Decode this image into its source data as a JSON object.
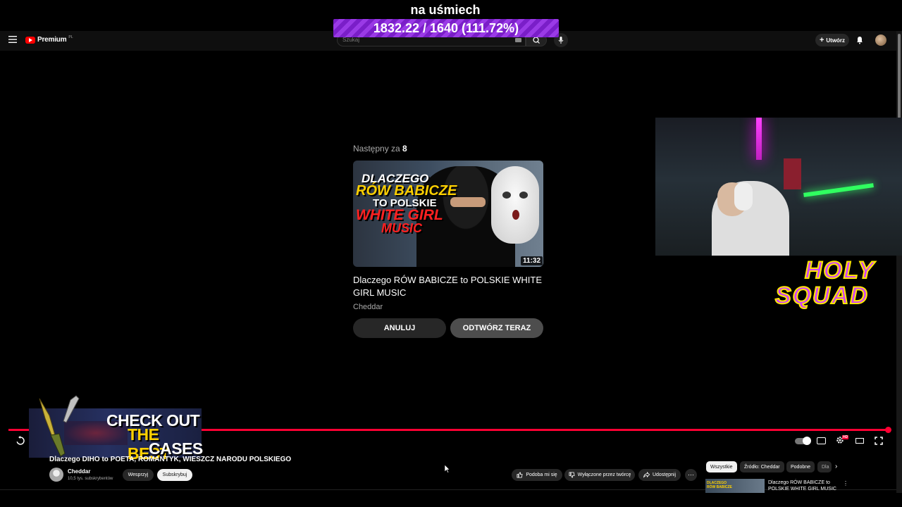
{
  "overlay": {
    "title": "na uśmiech",
    "progress_text": "1832.22 / 1640 (111.72%)",
    "progress_fraction": 1.0
  },
  "header": {
    "logo_text": "Premium",
    "logo_country": "PL",
    "search_placeholder": "Szukaj",
    "create_label": "Utwórz"
  },
  "up_next": {
    "label": "Następny za",
    "countdown": "8",
    "thumbnail": {
      "line1": "DLACZEGO",
      "line2": "RÓW BABICZE",
      "line3": "TO POLSKIE",
      "line4": "WHITE GIRL",
      "line5": "MUSIC",
      "duration": "11:32"
    },
    "title": "Dlaczego RÓW BABICZE to POLSKIE WHITE GIRL MUSIC",
    "channel": "Cheddar",
    "cancel_label": "ANULUJ",
    "play_now_label": "ODTWÓRZ TERAZ"
  },
  "stream_branding": {
    "holy_line1": "HOLY",
    "holy_line2": "SQUAD"
  },
  "promo": {
    "line1": "CHECK OUT",
    "line2": "THE BEST",
    "line3": "CASES"
  },
  "player": {
    "progress_fraction": 1.0,
    "hd_badge": "HD"
  },
  "video": {
    "title": "Dlaczego DIHO to POETA, ROMANTYK, WIESZCZ NARODU POLSKIEGO",
    "channel_name": "Cheddar",
    "subscribers": "10,5 tys. subskrybentów",
    "support_label": "Wesprzyj",
    "subscribe_label": "Subskrybuj",
    "like_label": "Podoba mi się",
    "dislike_label": "Wyłączone przez twórcę",
    "share_label": "Udostępnij"
  },
  "related": {
    "chips": [
      "Wszystkie",
      "Źródło: Cheddar",
      "Podobne",
      "Dla"
    ],
    "first_title": "Dlaczego RÓW BABICZE to POLSKIE WHITE GIRL MUSIC",
    "first_thumb_text": "DLACZEGO RÓW BABICZE"
  },
  "colors": {
    "accent_red": "#ff0033",
    "overlay_purple": "#9a3ae6",
    "holy_yellow": "#ffe800"
  }
}
